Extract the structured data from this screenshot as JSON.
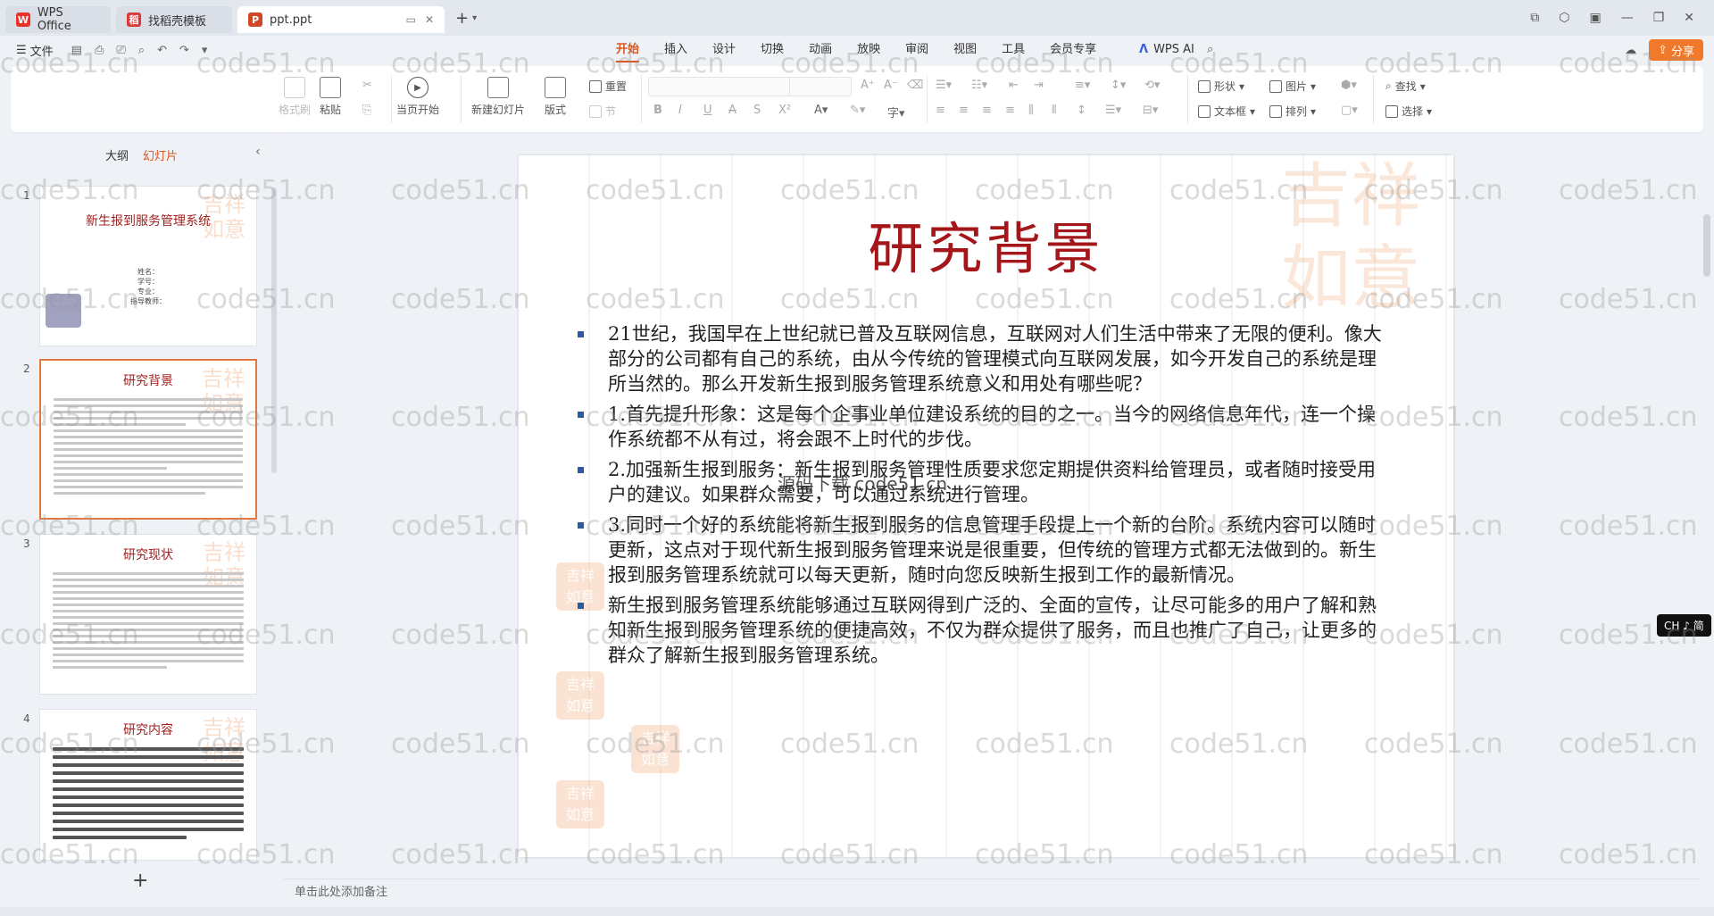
{
  "tabs": {
    "wps": "WPS Office",
    "template": "找稻壳模板",
    "active": "ppt.ppt"
  },
  "menubar": {
    "file": "文件",
    "tabs": [
      "开始",
      "插入",
      "设计",
      "切换",
      "动画",
      "放映",
      "审阅",
      "视图",
      "工具",
      "会员专享"
    ],
    "ai": "WPS AI",
    "share": "分享"
  },
  "ribbon": {
    "format_painter": "格式刷",
    "paste": "粘贴",
    "slideshow_current": "当页开始",
    "new_slide": "新建幻灯片",
    "layout": "版式",
    "reset": "重置",
    "section": "节",
    "shape": "形状",
    "picture": "图片",
    "textbox": "文本框",
    "arrange": "排列",
    "find": "查找",
    "select": "选择"
  },
  "left_panel": {
    "tab_outline": "大纲",
    "tab_slides": "幻灯片",
    "thumbnails": [
      {
        "num": "1",
        "title": "新生报到服务管理系统",
        "info": [
          "姓名：",
          "学号：",
          "专业：",
          "指导教师："
        ]
      },
      {
        "num": "2",
        "title": "研究背景"
      },
      {
        "num": "3",
        "title": "研究现状"
      },
      {
        "num": "4",
        "title": "研究内容"
      }
    ],
    "add": "+"
  },
  "slide": {
    "title": "研究背景",
    "bullets": [
      "21世纪，我国早在上世纪就已普及互联网信息，互联网对人们生活中带来了无限的便利。像大部分的公司都有自己的系统，由从今传统的管理模式向互联网发展，如今开发自己的系统是理所当然的。那么开发新生报到服务管理系统意义和用处有哪些呢？",
      "1.首先提升形象：这是每个企事业单位建设系统的目的之一。当今的网络信息年代，连一个操作系统都不从有过，将会跟不上时代的步伐。",
      "2.加强新生报到服务：新生报到服务管理性质要求您定期提供资料给管理员，或者随时接受用户的建议。如果群众需要，可以通过系统进行管理。",
      "3.同时一个好的系统能将新生报到服务的信息管理手段提上一个新的台阶。系统内容可以随时更新，这点对于现代新生报到服务管理来说是很重要，但传统的管理方式都无法做到的。新生报到服务管理系统就可以每天更新，随时向您反映新生报到工作的最新情况。",
      "新生报到服务管理系统能够通过互联网得到广泛的、全面的宣传，让尽可能多的用户了解和熟知新生报到服务管理系统的便捷高效，不仅为群众提供了服务，而且也推广了自己，让更多的群众了解新生报到服务管理系统。"
    ],
    "overlay": "源码下载 code51.cn"
  },
  "ime_badge": "CH ♪ 简",
  "notes_placeholder": "单击此处添加备注",
  "watermark": "code51.cn",
  "colors": {
    "accent": "#d9561e",
    "title_red": "#a5161b",
    "bullet_blue": "#2c5aa0"
  }
}
